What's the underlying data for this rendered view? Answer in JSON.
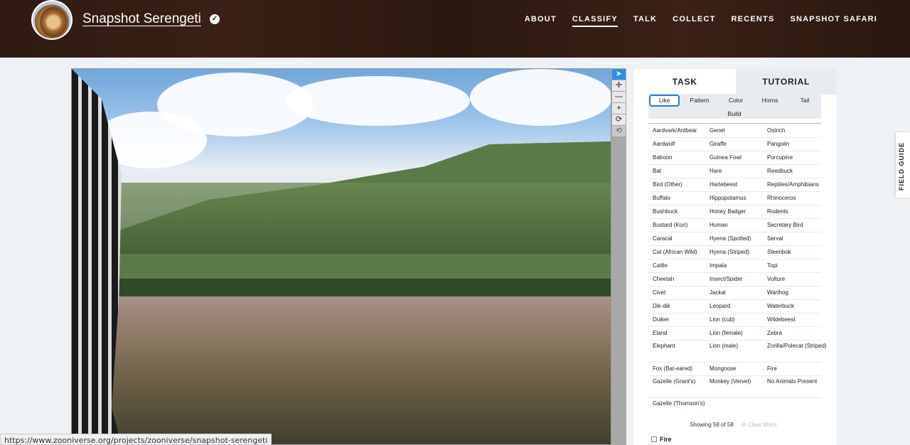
{
  "header": {
    "project_title": "Snapshot Serengeti",
    "nav": [
      "ABOUT",
      "CLASSIFY",
      "TALK",
      "COLLECT",
      "RECENTS",
      "SNAPSHOT SAFARI"
    ],
    "active_nav": "CLASSIFY"
  },
  "viewer": {
    "tools": [
      "pointer-icon",
      "move-icon",
      "zoom-out-icon",
      "zoom-in-icon",
      "rotate-icon",
      "reset-icon"
    ],
    "tool_glyphs": [
      "➤",
      "✛",
      "—",
      "+",
      "⟳",
      "⟲"
    ]
  },
  "panel": {
    "tabs": [
      "TASK",
      "TUTORIAL"
    ],
    "filters": [
      "Like",
      "Pattern",
      "Color",
      "Horns",
      "Tail",
      "Build"
    ],
    "species_col1": [
      "Aardvark/Antbear",
      "Aardwolf",
      "Baboon",
      "Bat",
      "Bird (Other)",
      "Buffalo",
      "Bushbuck",
      "Bustard (Kori)",
      "Caracal",
      "Cat (African Wild)",
      "Cattle",
      "Cheetah",
      "Civet",
      "Dik-dik",
      "Duiker",
      "Eland",
      "Elephant",
      "Fox (Bat-eared)",
      "Gazelle (Grant's)",
      "Gazelle (Thomson's)"
    ],
    "species_col2": [
      "Genet",
      "Giraffe",
      "Guinea Fowl",
      "Hare",
      "Hartebeest",
      "Hippopotamus",
      "Honey Badger",
      "Human",
      "Hyena (Spotted)",
      "Hyena (Striped)",
      "Impala",
      "Insect/Spider",
      "Jackal",
      "Leopard",
      "Lion (cub)",
      "Lion (female)",
      "Lion (male)",
      "Mongoose",
      "Monkey (Vervet)"
    ],
    "species_col3": [
      "Ostrich",
      "Pangolin",
      "Porcupine",
      "Reedbuck",
      "Reptiles/Amphibians",
      "Rhinoceros",
      "Rodents",
      "Secretary Bird",
      "Serval",
      "Steenbok",
      "Topi",
      "Vulture",
      "Warthog",
      "Waterbuck",
      "Wildebeest",
      "Zebra",
      "Zorilla/Polecat (Striped)",
      "Fire",
      "No Animals Present"
    ],
    "showing": "Showing 58 of 58",
    "clear_filters": "Clear filters",
    "fire_checkbox": "Fire"
  },
  "field_guide": "FIELD GUIDE",
  "status_url": "https://www.zooniverse.org/projects/zooniverse/snapshot-serengeti"
}
